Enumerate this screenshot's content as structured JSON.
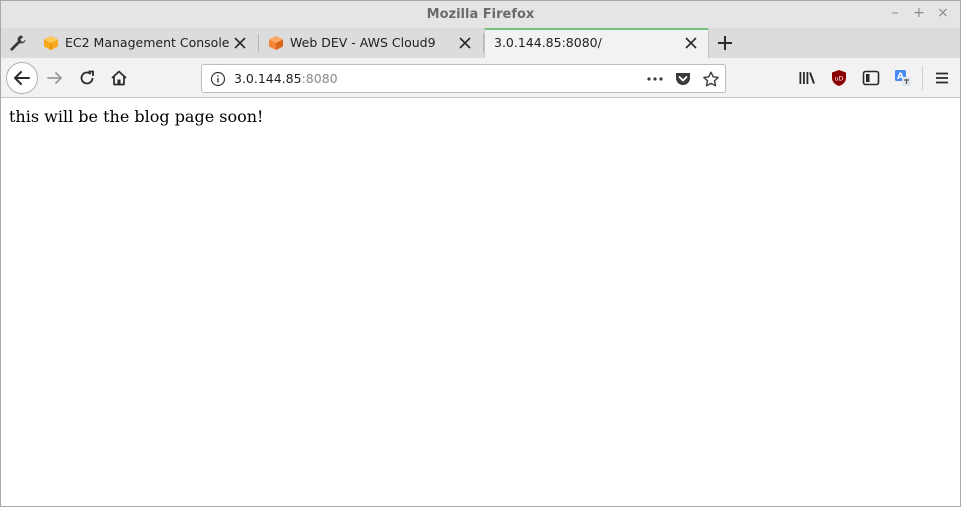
{
  "window": {
    "title": "Mozilla Firefox"
  },
  "tabs": [
    {
      "label": "EC2 Management Console",
      "favicon": "aws-cube-icon"
    },
    {
      "label": "Web DEV - AWS Cloud9",
      "favicon": "cloud9-icon"
    },
    {
      "label": "3.0.144.85:8080/",
      "favicon": ""
    }
  ],
  "active_tab_index": 2,
  "address_bar": {
    "host": "3.0.144.85",
    "port": ":8080"
  },
  "page": {
    "text": "this will be the blog page soon!"
  },
  "colors": {
    "active_tab_accent": "#75c17b",
    "ublock_red": "#8b0000",
    "translate_blue": "#4a8af4"
  }
}
